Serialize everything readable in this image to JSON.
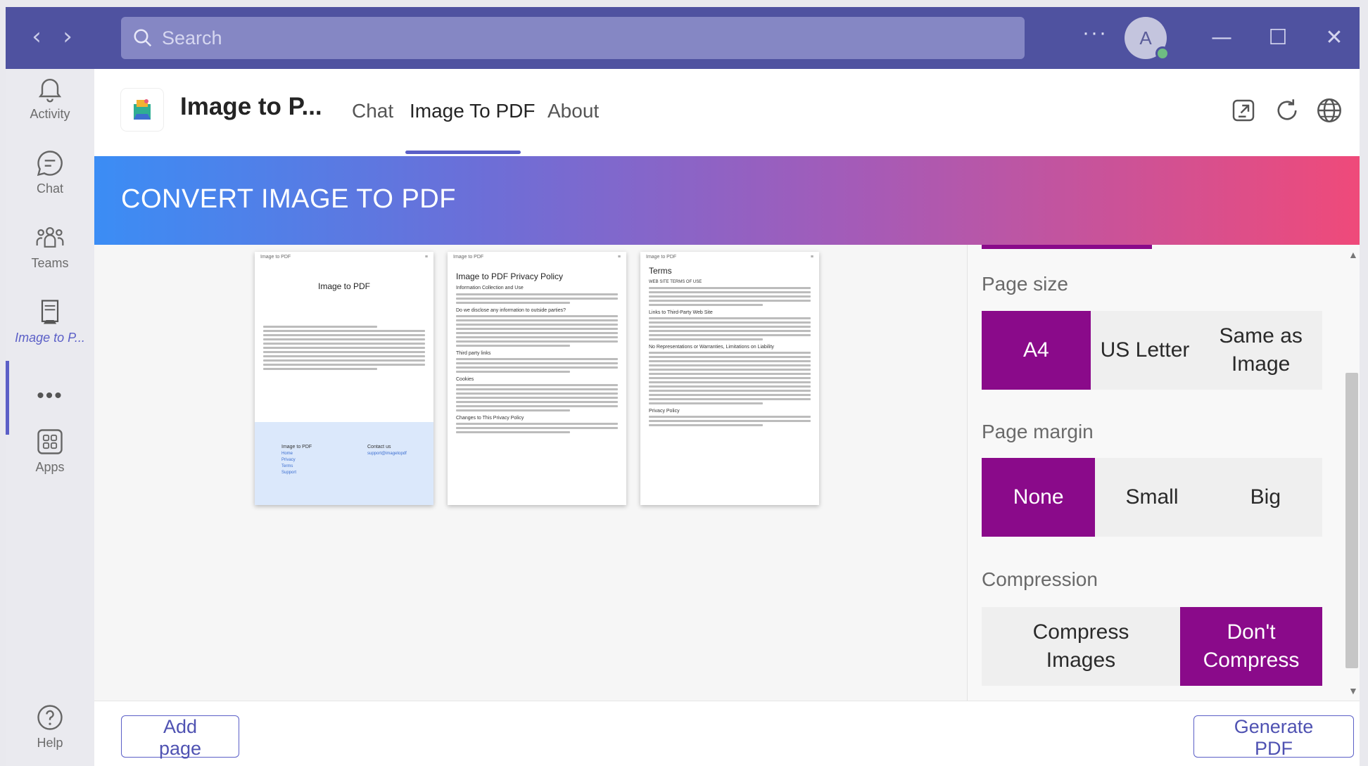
{
  "titlebar": {
    "search_placeholder": "Search",
    "more": "···",
    "avatar_initial": "A"
  },
  "rail": {
    "items": [
      {
        "label": "Activity"
      },
      {
        "label": "Chat"
      },
      {
        "label": "Teams"
      },
      {
        "label": "Image to P..."
      },
      {
        "label": "Apps"
      },
      {
        "label": "Help"
      }
    ],
    "more": "•••"
  },
  "app": {
    "title": "Image to P...",
    "tabs": [
      {
        "label": "Chat"
      },
      {
        "label": "Image To PDF"
      },
      {
        "label": "About"
      }
    ]
  },
  "banner": {
    "title": "CONVERT IMAGE TO PDF"
  },
  "pages": [
    {
      "header": "Image to PDF",
      "title": "Image to PDF",
      "footer_cols": [
        {
          "title": "Image to PDF",
          "links": [
            "Home",
            "Privacy",
            "Terms",
            "Support"
          ]
        },
        {
          "title": "Contact us",
          "links": [
            "support@imagetopdf"
          ]
        }
      ]
    },
    {
      "header": "Image to PDF",
      "title": "Image to PDF Privacy Policy",
      "headings": [
        "Information Collection and Use",
        "Do we disclose any information to outside parties?",
        "Third party links",
        "Cookies",
        "Changes to This Privacy Policy"
      ]
    },
    {
      "header": "Image to PDF",
      "title": "Terms",
      "headings": [
        "WEB SITE TERMS OF USE",
        "Links to Third-Party Web Site",
        "No Representations or Warranties, Limitations on Liability",
        "Privacy Policy"
      ]
    }
  ],
  "settings": {
    "page_size": {
      "label": "Page size",
      "options": [
        "A4",
        "US Letter",
        "Same as Image"
      ],
      "selected": "A4"
    },
    "page_margin": {
      "label": "Page margin",
      "options": [
        "None",
        "Small",
        "Big"
      ],
      "selected": "None"
    },
    "compression": {
      "label": "Compression",
      "options": [
        "Compress Images",
        "Don't Compress"
      ],
      "selected": "Don't Compress"
    }
  },
  "footer": {
    "add_page": "Add page",
    "generate": "Generate PDF"
  },
  "colors": {
    "titlebar": "#4f52a0",
    "accent": "#5b5fc7",
    "selected": "#8a0a8a"
  }
}
